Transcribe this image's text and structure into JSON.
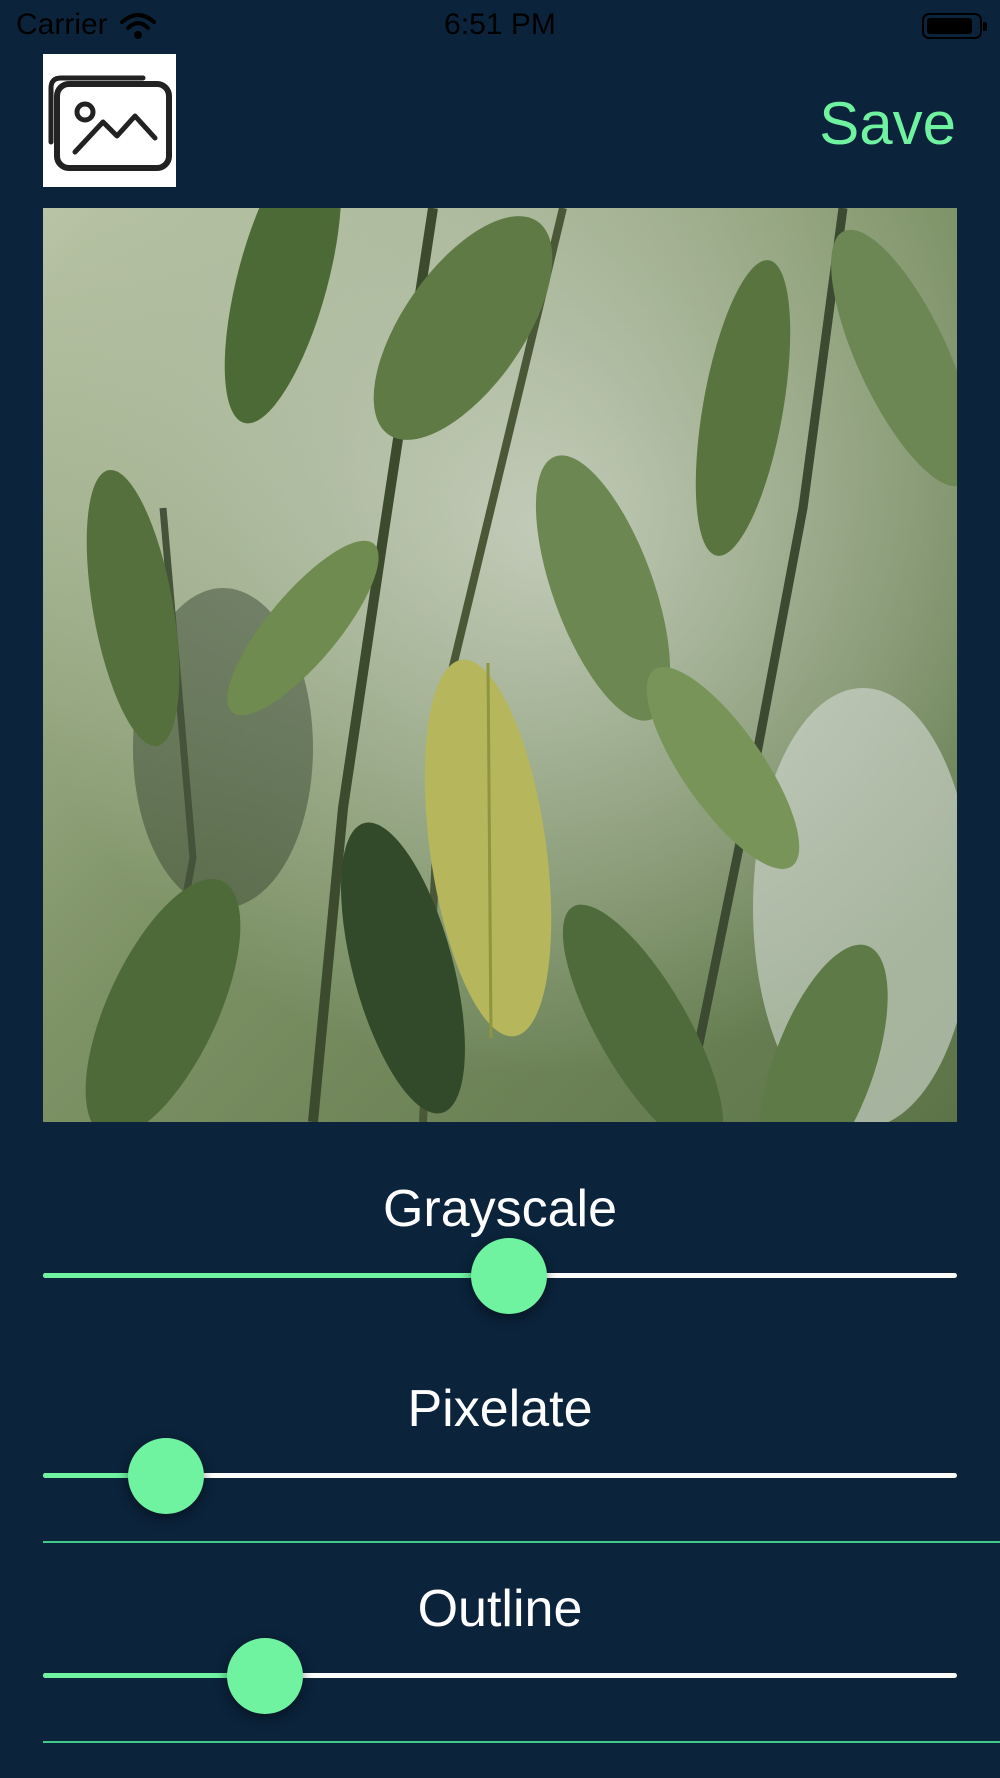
{
  "status_bar": {
    "carrier": "Carrier",
    "time": "6:51 PM",
    "icons": [
      "wifi-icon",
      "battery-icon"
    ]
  },
  "toolbar": {
    "gallery_icon": "photo-gallery-icon",
    "save_label": "Save"
  },
  "photo": {
    "description_icon": "photo-preview"
  },
  "filters": [
    {
      "label": "Grayscale",
      "value": 0.51
    },
    {
      "label": "Pixelate",
      "value": 0.135
    },
    {
      "label": "Outline",
      "value": 0.243
    }
  ],
  "colors": {
    "background": "#0b233b",
    "accent": "#6ff3a1",
    "track": "#ffffff"
  }
}
